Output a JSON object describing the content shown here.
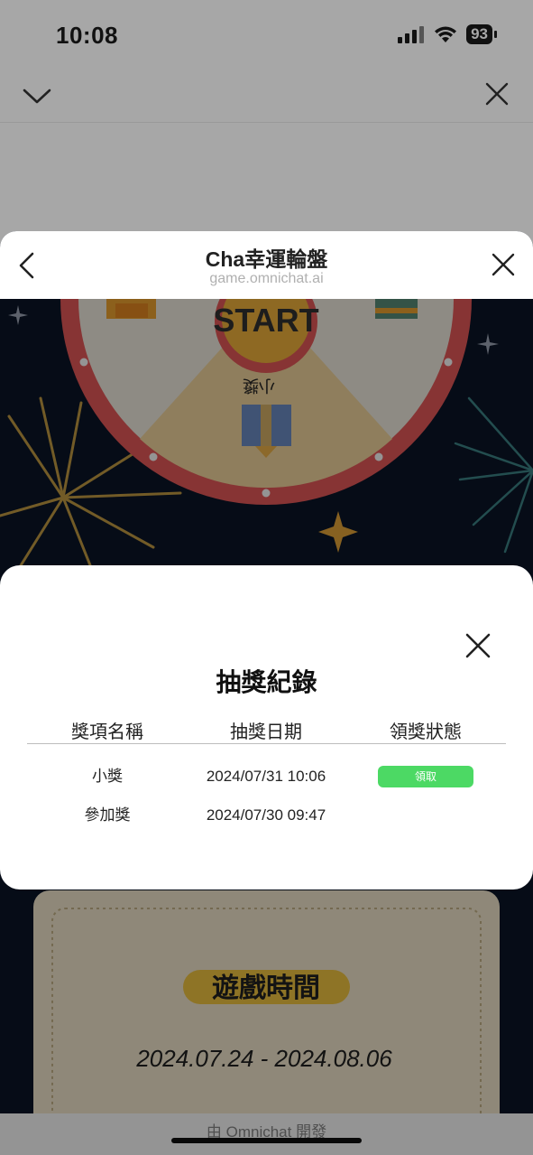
{
  "status_bar": {
    "time": "10:08",
    "battery": "93"
  },
  "sheet": {
    "title": "Cha幸運輪盤",
    "url": "game.omnichat.ai"
  },
  "game": {
    "start_label": "START",
    "segment_label": "小獎",
    "period_title": "遊戲時間",
    "period_dates": "2024.07.24 - 2024.08.06"
  },
  "footer": {
    "credit": "由 Omnichat 開發"
  },
  "modal": {
    "title": "抽獎紀錄",
    "columns": [
      "獎項名稱",
      "抽獎日期",
      "領獎狀態"
    ],
    "rows": [
      {
        "prize": "小獎",
        "date": "2024/07/31 10:06",
        "action": "領取"
      },
      {
        "prize": "參加獎",
        "date": "2024/07/30 09:47",
        "action": ""
      }
    ]
  },
  "colors": {
    "claim_button": "#4cd964",
    "background": "#0b1628",
    "accent": "#f0c040"
  }
}
